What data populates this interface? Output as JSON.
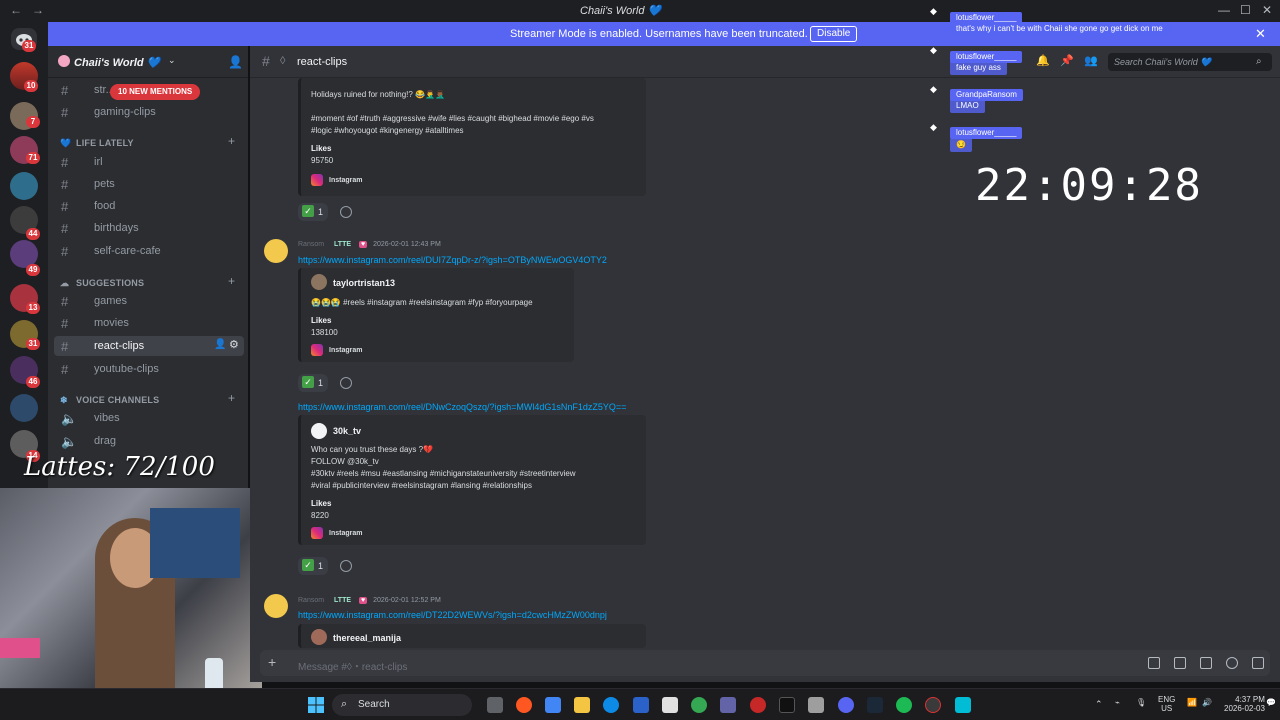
{
  "window": {
    "title": "Chaii's World 💙",
    "back": "←",
    "forward": "→",
    "minimize": "—",
    "maximize": "☐",
    "close": "✕"
  },
  "banner": {
    "message": "Streamer Mode is enabled. Usernames have been truncated.",
    "button": "Disable",
    "close": "✕"
  },
  "server": {
    "name": "Chaii's World 💙",
    "mentions_pill": "10 NEW MENTIONS"
  },
  "rail_badges": [
    "31",
    "10",
    "7",
    "71",
    "44",
    "49",
    "13",
    "31",
    "46",
    "14"
  ],
  "channels": {
    "top": [
      {
        "label": "str...",
        "id": "stream"
      },
      {
        "label": "gaming-clips",
        "id": "gaming-clips"
      }
    ],
    "life_lately": {
      "label": "LIFE LATELY",
      "items": [
        {
          "label": "irl"
        },
        {
          "label": "pets"
        },
        {
          "label": "food"
        },
        {
          "label": "birthdays"
        },
        {
          "label": "self-care-cafe"
        }
      ]
    },
    "suggestions": {
      "label": "SUGGESTIONS",
      "items": [
        {
          "label": "games"
        },
        {
          "label": "movies"
        },
        {
          "label": "react-clips"
        },
        {
          "label": "youtube-clips"
        }
      ]
    },
    "voice": {
      "label": "VOICE CHANNELS",
      "items": [
        {
          "label": "vibes"
        },
        {
          "label": "drag"
        }
      ]
    }
  },
  "stream_overlay": {
    "lattes": "Lattes: 72/100",
    "clock": "22:09:28",
    "chat": [
      {
        "name": "lotusflower_____",
        "text": "that's why i can't be with Chaii she gone go get dick on me"
      },
      {
        "name": "lotusflower_____",
        "text": "fake guy ass"
      },
      {
        "name": "GrandpaRansom",
        "text": "LMAO"
      },
      {
        "name": "lotusflower_____",
        "text": "😏"
      }
    ]
  },
  "chat": {
    "channel": "react-clips",
    "search_placeholder": "Search Chaii's World 💙",
    "composer_placeholder": "Message #◊・react-clips",
    "messages": [
      {
        "embed": {
          "text1": "Holidays ruined for nothing!? 😂🤦‍♂️🤦🏾‍♂️",
          "text2": "#moment #of #truth #aggressive #wife #lies #caught #bighead #movie #ego #vs",
          "text3": "#logic #whoyougot #kingenergy #atalltimes",
          "likes_label": "Likes",
          "likes": "95750",
          "source": "Instagram"
        },
        "reaction_count": "1"
      },
      {
        "author": "Ransom",
        "tag": "LTTE",
        "time": "2026-02-01 12:43 PM",
        "link": "https://www.instagram.com/reel/DUI7ZqpDr-z/?igsh=OTByNWEwOGV4OTY2",
        "embed": {
          "author": "taylortristan13",
          "text1": "😭😭😭 #reels #instagram #reelsinstagram #fyp #foryourpage",
          "likes_label": "Likes",
          "likes": "138100",
          "source": "Instagram"
        },
        "reaction_count": "1"
      },
      {
        "link": "https://www.instagram.com/reel/DNwCzoqQszq/?igsh=MWl4dG1sNnF1dzZ5YQ==",
        "embed": {
          "author": "30k_tv",
          "text1": "Who can you trust these days ?💔",
          "text2": "FOLLOW @30k_tv",
          "text3": "#30ktv #reels #msu #eastlansing #michiganstateuniversity #streetinterview",
          "text4": "#viral #publicinterview #reelsinstagram #lansing #relationships",
          "likes_label": "Likes",
          "likes": "8220",
          "source": "Instagram"
        },
        "reaction_count": "1"
      },
      {
        "author": "Ransom",
        "tag": "LTTE",
        "time": "2026-02-01 12:52 PM",
        "link": "https://www.instagram.com/reel/DT22D2WEWVs/?igsh=d2cwcHMzZW00dnpj",
        "embed": {
          "author": "thereeal_manija"
        }
      }
    ]
  },
  "taskbar": {
    "search": "Search",
    "lang1": "ENG",
    "lang2": "US",
    "time": "4:37 PM",
    "date": "2026-02-03"
  },
  "colors": {
    "blurple": "#5865f2",
    "link": "#00a8fc",
    "mention": "#da373c"
  }
}
